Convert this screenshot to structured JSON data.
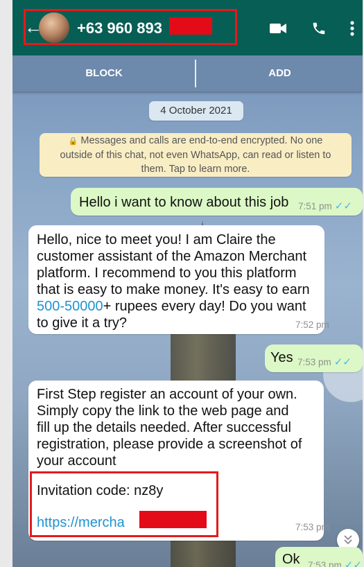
{
  "header": {
    "contact_name": "+63 960 893",
    "back_icon": "arrow-left-icon",
    "video_icon": "video-call-icon",
    "call_icon": "phone-call-icon",
    "menu_icon": "more-vert-icon",
    "bg_color": "#075e54"
  },
  "action_bar": {
    "block_label": "BLOCK",
    "add_label": "ADD"
  },
  "chat": {
    "date_chip": "4 October 2021",
    "encryption_notice": {
      "line1": "Messages and calls are end-to-end encrypted. No one",
      "line2": "outside of this chat, not even WhatsApp, can read or listen to",
      "line3": "them. Tap to learn more."
    },
    "messages": [
      {
        "direction": "outgoing",
        "text": "Hello i want to know about this job",
        "time": "7:51 pm",
        "status": "read"
      },
      {
        "direction": "incoming",
        "lines": [
          "Hello, nice to meet you! I am Claire the",
          "customer assistant of the Amazon Merchant",
          "platform. I recommend to you this platform",
          "that is easy to make money. It's easy to earn"
        ],
        "line5_link": "500-50000",
        "line5_rest": "+ rupees every day! Do you want",
        "line6": "to give it a try?",
        "time": "7:52 pm"
      },
      {
        "direction": "outgoing",
        "text": "Yes",
        "time": "7:53 pm",
        "status": "read"
      },
      {
        "direction": "incoming",
        "lines": [
          "First Step register an account of your own.",
          "Simply copy the link to the web page and",
          "fill up the details needed. After successful",
          "registration, please provide a screenshot of",
          "your account"
        ],
        "invitation_code": "Invitation code: nz8y",
        "link": "https://mercha",
        "time": "7:53 pm"
      },
      {
        "direction": "outgoing",
        "text": "Ok",
        "time": "7:53 pm",
        "status": "read"
      }
    ],
    "ticks_glyph": "✓✓",
    "scroll_icon": "double-chevron-down-icon",
    "outgoing_color": "#dcf8c6",
    "incoming_color": "#ffffff",
    "link_color": "#1d93cf",
    "redaction_color": "#e30b17"
  }
}
